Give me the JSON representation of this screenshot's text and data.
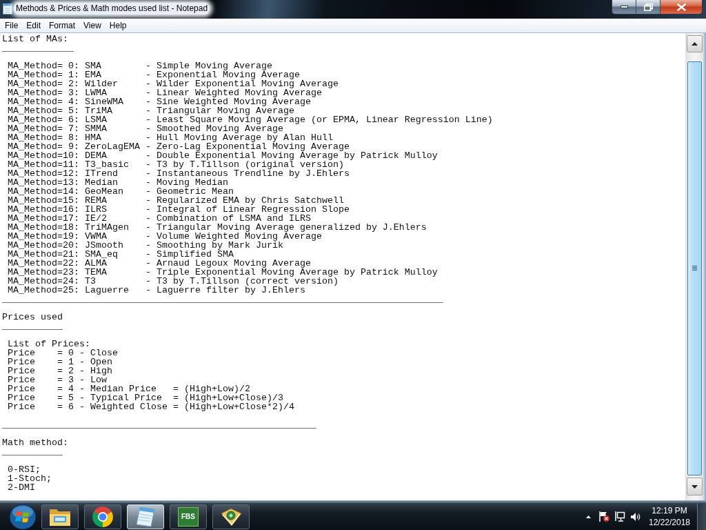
{
  "window": {
    "title": "Methods & Prices & Math modes used list - Notepad"
  },
  "menu": [
    "File",
    "Edit",
    "Format",
    "View",
    "Help"
  ],
  "document": {
    "paragraphs": [
      [
        "List of MAs:",
        "_____________"
      ],
      [
        " MA_Method= 0: SMA        - Simple Moving Average",
        " MA_Method= 1: EMA        - Exponential Moving Average",
        " MA_Method= 2: Wilder     - Wilder Exponential Moving Average",
        " MA_Method= 3: LWMA       - Linear Weighted Moving Average",
        " MA_Method= 4: SineWMA    - Sine Weighted Moving Average",
        " MA_Method= 5: TriMA      - Triangular Moving Average",
        " MA_Method= 6: LSMA       - Least Square Moving Average (or EPMA, Linear Regression Line)",
        " MA_Method= 7: SMMA       - Smoothed Moving Average",
        " MA_Method= 8: HMA        - Hull Moving Average by Alan Hull",
        " MA_Method= 9: ZeroLagEMA - Zero-Lag Exponential Moving Average",
        " MA_Method=10: DEMA       - Double Exponential Moving Average by Patrick Mulloy",
        " MA_Method=11: T3_basic   - T3 by T.Tillson (original version)",
        " MA_Method=12: ITrend     - Instantaneous Trendline by J.Ehlers",
        " MA_Method=13: Median     - Moving Median",
        " MA_Method=14: GeoMean    - Geometric Mean",
        " MA_Method=15: REMA       - Regularized EMA by Chris Satchwell",
        " MA_Method=16: ILRS       - Integral of Linear Regression Slope",
        " MA_Method=17: IE/2       - Combination of LSMA and ILRS",
        " MA_Method=18: TriMAgen   - Triangular Moving Average generalized by J.Ehlers",
        " MA_Method=19: VWMA       - Volume Weighted Moving Average",
        " MA_Method=20: JSmooth    - Smoothing by Mark Jurik",
        " MA_Method=21: SMA_eq     - Simplified SMA",
        " MA_Method=22: ALMA       - Arnaud Legoux Moving Average",
        " MA_Method=23: TEMA       - Triple Exponential Moving Average by Patrick Mulloy",
        " MA_Method=24: T3         - T3 by T.Tillson (correct version)",
        " MA_Method=25: Laguerre   - Laguerre filter by J.Ehlers",
        "________________________________________________________________________________"
      ],
      [
        "Prices used",
        "___________"
      ],
      [
        " List of Prices:",
        " Price    = 0 - Close",
        " Price    = 1 - Open",
        " Price    = 2 - High",
        " Price    = 3 - Low",
        " Price    = 4 - Median Price   = (High+Low)/2",
        " Price    = 5 - Typical Price  = (High+Low+Close)/3",
        " Price    = 6 - Weighted Close = (High+Low+Close*2)/4"
      ],
      [
        "_________________________________________________________"
      ],
      [
        "Math method:",
        "___________"
      ],
      [
        " 0-RSI;",
        " 1-Stoch;",
        " 2-DMI"
      ]
    ]
  },
  "taskbar": {
    "apps": [
      {
        "kind": "folder",
        "selected": false
      },
      {
        "kind": "browser",
        "selected": false
      },
      {
        "kind": "notepad",
        "selected": true
      },
      {
        "kind": "tile",
        "label": "FBS",
        "selected": false
      },
      {
        "kind": "emblem",
        "selected": false
      }
    ],
    "clock": {
      "time": "12:19 PM",
      "date": "12/22/2018"
    }
  }
}
